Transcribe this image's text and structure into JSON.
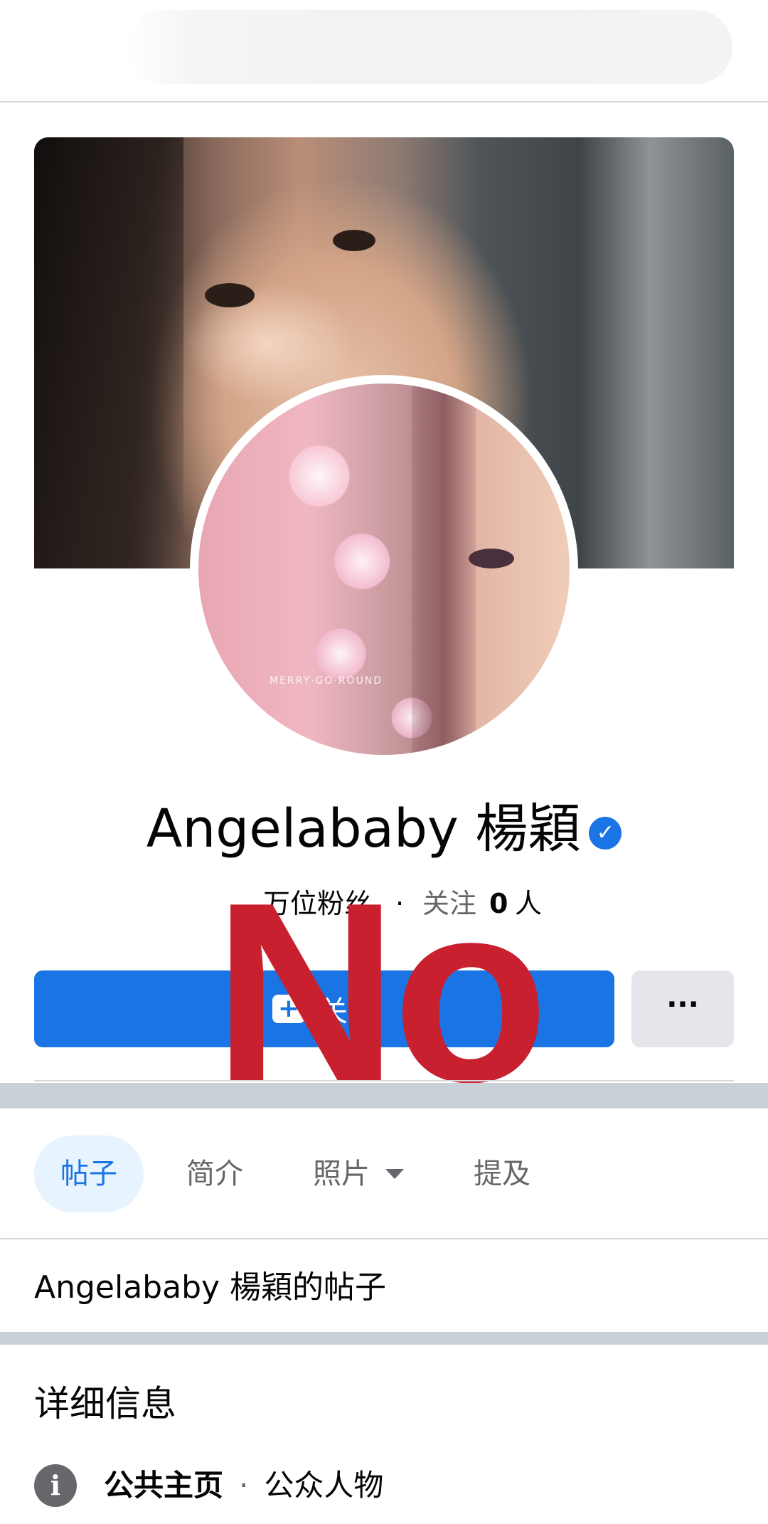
{
  "profile": {
    "name": "Angelababy 楊穎",
    "stats": {
      "followers_suffix": "万位粉丝",
      "following_label": "关注",
      "following_count": "0",
      "following_unit": "人",
      "separator": "·"
    }
  },
  "actions": {
    "follow_label": "关注",
    "more_label": "···"
  },
  "overlay_text": "No",
  "tabs": [
    {
      "label": "帖子",
      "active": true
    },
    {
      "label": "简介",
      "active": false
    },
    {
      "label": "照片",
      "active": false
    },
    {
      "label": "提及",
      "active": false
    }
  ],
  "posts_header": "Angelababy 楊穎的帖子",
  "details": {
    "title": "详细信息",
    "info_label": "公共主页",
    "info_sep": "·",
    "info_value": "公众人物"
  },
  "colors": {
    "brand_blue": "#1b74e4",
    "overlay_red": "#c8202f",
    "separator_gray": "#cad0d8"
  },
  "icons": [
    "verified-badge-icon",
    "follow-add-icon",
    "more-dots-icon",
    "caret-down-icon",
    "info-icon"
  ]
}
